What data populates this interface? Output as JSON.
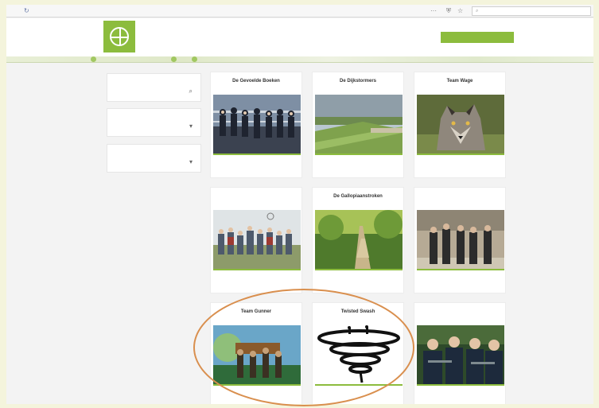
{
  "browser": {
    "url": "",
    "zoom": "",
    "search_placeholder": ""
  },
  "header": {
    "nav": [
      "",
      "",
      "",
      "",
      ""
    ],
    "cta_label": ""
  },
  "filters": [
    {
      "label": "",
      "value": "",
      "icon": "search-icon"
    },
    {
      "label": "",
      "value": "",
      "icon": "chevron-down-icon"
    },
    {
      "label": "",
      "value": "",
      "icon": "chevron-down-icon"
    }
  ],
  "teams": [
    {
      "name": "De Gevoelde Boeken",
      "stats": [
        {
          "num": "",
          "label": ""
        },
        {
          "num": "",
          "label": ""
        },
        {
          "num": "",
          "label": ""
        }
      ]
    },
    {
      "name": "De Dijkstormers",
      "stats": [
        {
          "num": "",
          "label": ""
        },
        {
          "num": "",
          "label": ""
        },
        {
          "num": "",
          "label": ""
        }
      ]
    },
    {
      "name": "Team Wage",
      "stats": [
        {
          "num": "",
          "label": ""
        },
        {
          "num": "",
          "label": ""
        },
        {
          "num": "",
          "label": ""
        }
      ]
    },
    {
      "name": "",
      "stats": [
        {
          "num": "",
          "label": ""
        },
        {
          "num": "",
          "label": ""
        },
        {
          "num": "",
          "label": ""
        }
      ]
    },
    {
      "name": "De Gallopiaanstroken",
      "stats": [
        {
          "num": "",
          "label": ""
        },
        {
          "num": "",
          "label": ""
        },
        {
          "num": "",
          "label": ""
        }
      ]
    },
    {
      "name": "",
      "stats": [
        {
          "num": "",
          "label": ""
        },
        {
          "num": "",
          "label": ""
        },
        {
          "num": "",
          "label": ""
        }
      ]
    },
    {
      "name": "Team Gunner",
      "stats": [
        {
          "num": "",
          "label": ""
        },
        {
          "num": "",
          "label": ""
        },
        {
          "num": "",
          "label": ""
        }
      ]
    },
    {
      "name": "Twisted Swash",
      "stats": [
        {
          "num": "",
          "label": ""
        },
        {
          "num": "",
          "label": ""
        },
        {
          "num": "",
          "label": ""
        }
      ]
    },
    {
      "name": "",
      "stats": [
        {
          "num": "",
          "label": ""
        },
        {
          "num": "",
          "label": ""
        },
        {
          "num": "",
          "label": ""
        }
      ]
    }
  ],
  "colors": {
    "brand_green": "#8cbc3d",
    "highlight_orange": "#d98f4e",
    "background": "#f4f4dc"
  }
}
